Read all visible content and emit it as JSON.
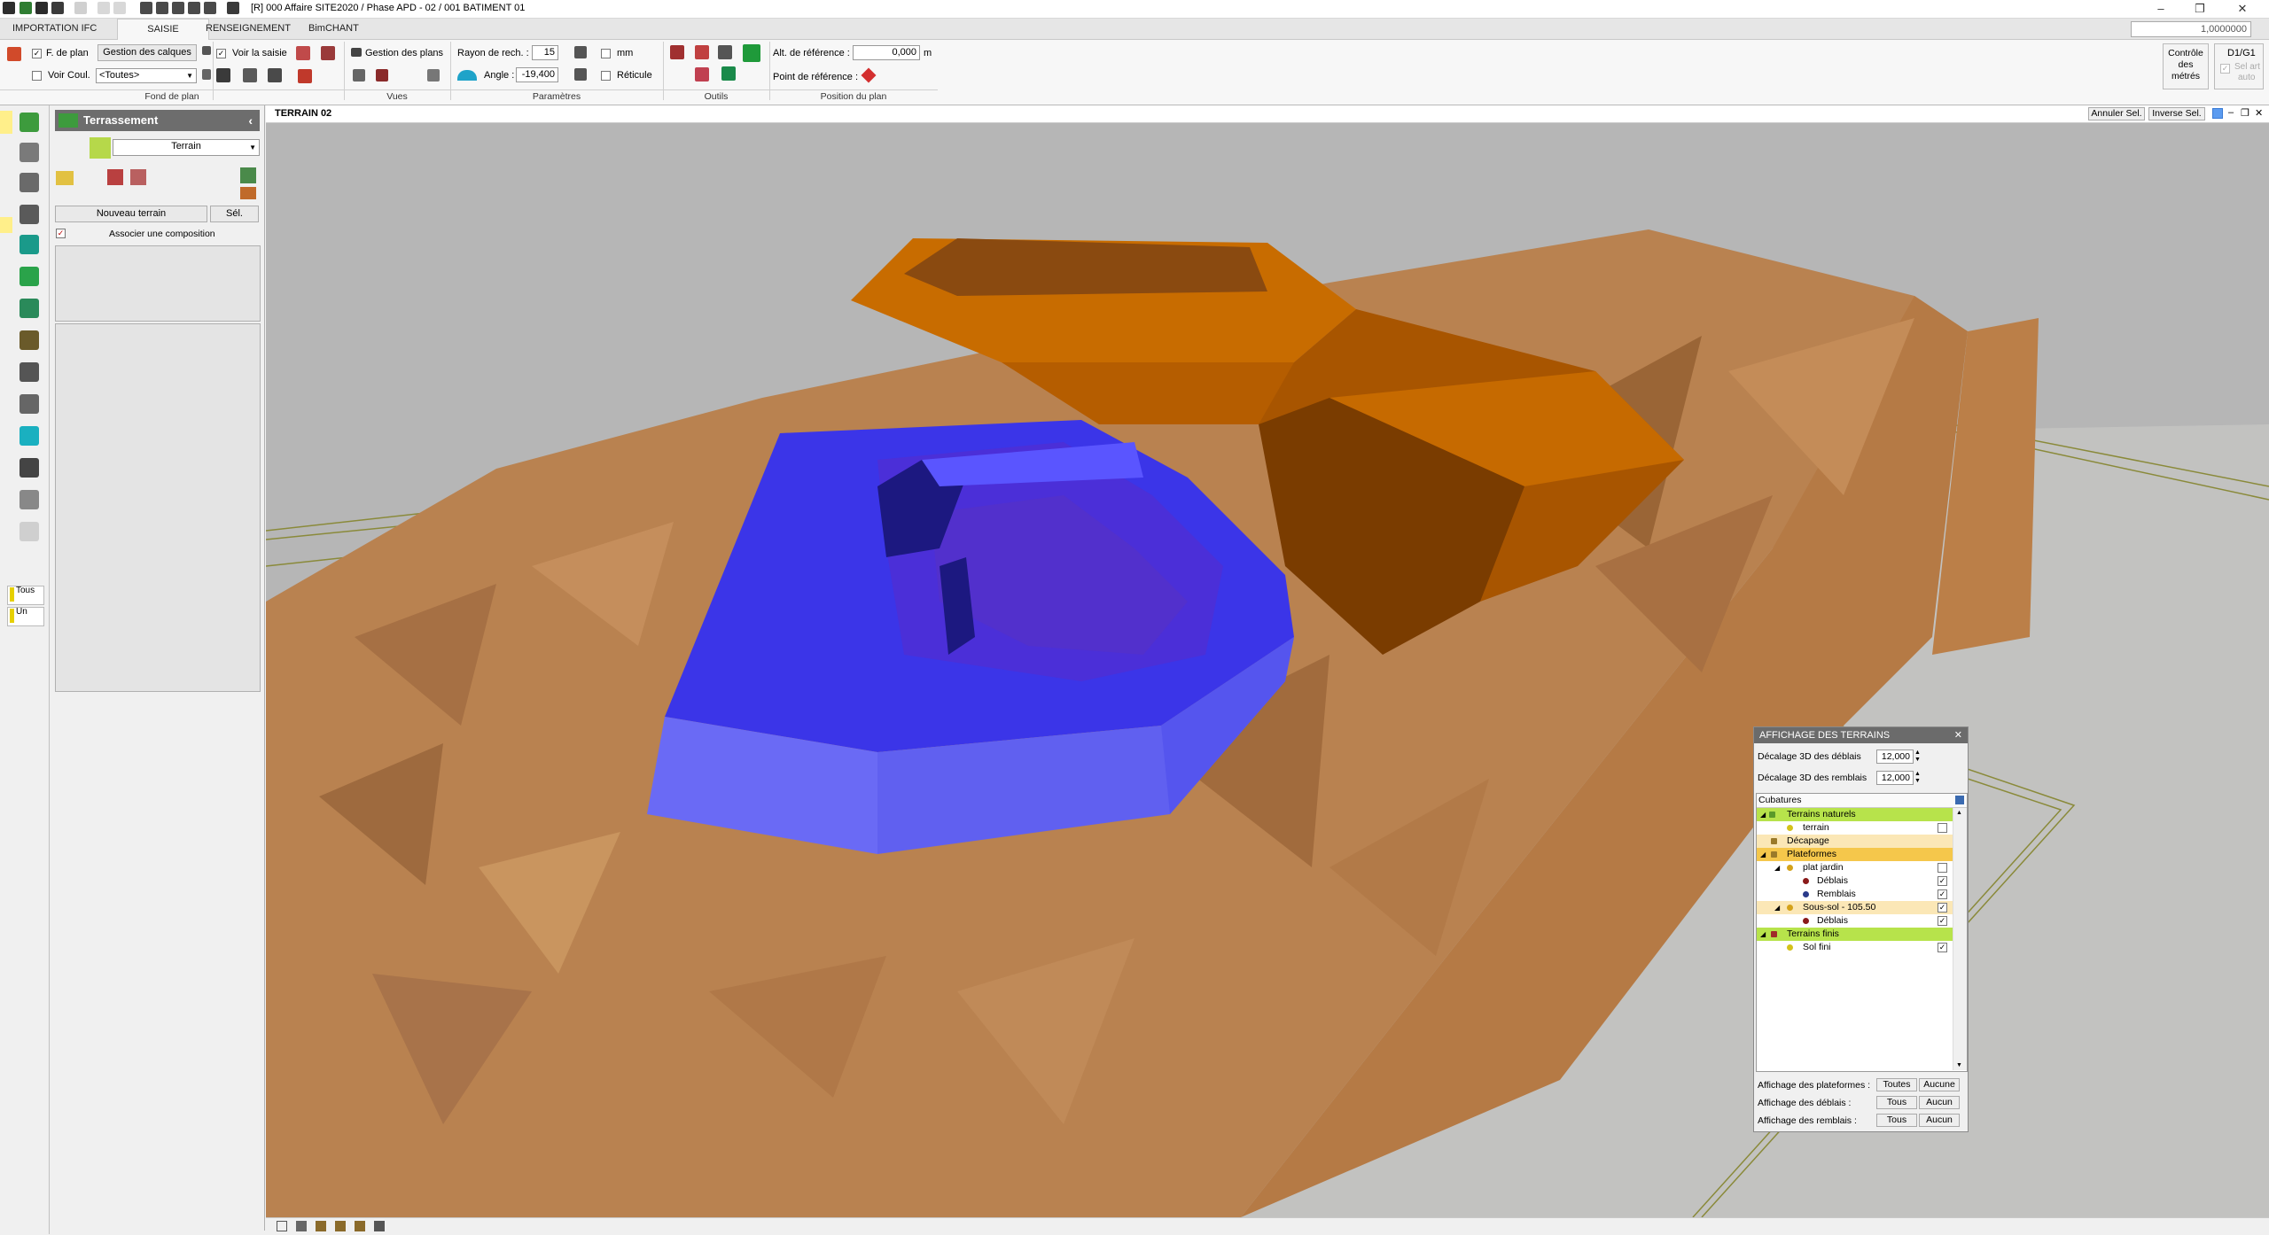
{
  "window": {
    "title": "[R] 000  Affaire SITE2020 / Phase APD - 02 / 001 BATIMENT 01",
    "zoom_value": "1,0000000"
  },
  "tabs": [
    "IMPORTATION IFC",
    "SAISIE",
    "RENSEIGNEMENT",
    "BimCHANT"
  ],
  "ribbon": {
    "fond_de_plan": {
      "f_de_plan": "F. de plan",
      "gestion_calques": "Gestion des calques",
      "voir_coul": "Voir Coul.",
      "toutes": "<Toutes>",
      "label": "Fond de plan"
    },
    "vues": {
      "voir_saisie": "Voir la saisie",
      "gestion_plans": "Gestion des plans",
      "label": "Vues"
    },
    "parametres": {
      "rayon_label": "Rayon de rech. :",
      "rayon_value": "15",
      "mm_label": "mm",
      "angle_label": "Angle :",
      "angle_value": "-19,400",
      "reticule_label": "Réticule",
      "label": "Paramètres"
    },
    "outils": {
      "label": "Outils"
    },
    "position": {
      "alt_label": "Alt. de référence :",
      "alt_value": "0,000",
      "alt_unit": "m",
      "point_label": "Point de référence :",
      "label": "Position du plan"
    },
    "controle": {
      "line1": "Contrôle",
      "line2": "des",
      "line3": "métrés"
    },
    "d1g1": {
      "title": "D1/G1",
      "line1": "Sel art",
      "line2": "auto"
    }
  },
  "left_toolbar": {
    "tous": "Tous",
    "un": "Un"
  },
  "panel": {
    "title": "Terrassement",
    "dropdown_value": "Terrain",
    "nouveau_terrain": "Nouveau terrain",
    "sel": "Sél.",
    "associer": "Associer une composition"
  },
  "viewport": {
    "title": "TERRAIN 02",
    "annuler_sel": "Annuler Sel.",
    "inverse_sel": "Inverse Sel."
  },
  "dialog": {
    "title": "AFFICHAGE DES TERRAINS",
    "decalage_deblais_label": "Décalage 3D des déblais",
    "decalage_deblais_value": "12,000",
    "decalage_remblais_label": "Décalage 3D des remblais",
    "decalage_remblais_value": "12,000",
    "tree_header": "Cubatures",
    "tree": [
      {
        "label": "Terrains naturels",
        "style": "green",
        "level": 0
      },
      {
        "label": "terrain",
        "style": "",
        "level": 1,
        "checked": false
      },
      {
        "label": "Décapage",
        "style": "lightor",
        "level": 0
      },
      {
        "label": "Plateformes",
        "style": "orange",
        "level": 0
      },
      {
        "label": "plat jardin",
        "style": "",
        "level": 1,
        "checked": false
      },
      {
        "label": "Déblais",
        "style": "",
        "level": 2,
        "checked": true
      },
      {
        "label": "Remblais",
        "style": "",
        "level": 2,
        "checked": true
      },
      {
        "label": "Sous-sol - 105.50",
        "style": "lightor",
        "level": 1,
        "checked": true
      },
      {
        "label": "Déblais",
        "style": "",
        "level": 2,
        "checked": true
      },
      {
        "label": "Terrains finis",
        "style": "green",
        "level": 0
      },
      {
        "label": "Sol fini",
        "style": "",
        "level": 1,
        "checked": true
      }
    ],
    "affichage_plateformes": "Affichage des plateformes :",
    "affichage_deblais": "Affichage des déblais :",
    "affichage_remblais": "Affichage des remblais :",
    "toutes": "Toutes",
    "aucune": "Aucune",
    "tous": "Tous",
    "aucun": "Aucun"
  },
  "colors": {
    "terrain": "#b98250",
    "terrain_dark": "#8f5a2c",
    "platform_orange": "#c86c00",
    "platform_dark": "#7a3c00",
    "excavation_blue": "#3b35e8",
    "excavation_light": "#6a6af5",
    "background_grey": "#b6b6b6",
    "green_tag": "#b7e34b"
  }
}
